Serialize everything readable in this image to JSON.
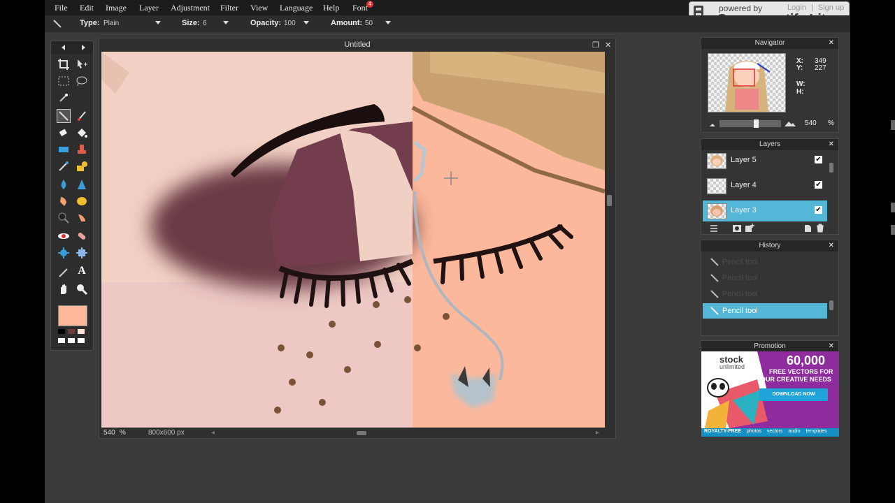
{
  "menu": {
    "items": [
      "File",
      "Edit",
      "Image",
      "Layer",
      "Adjustment",
      "Filter",
      "View",
      "Language",
      "Help",
      "Font"
    ],
    "font_badge": "4"
  },
  "watermark": {
    "powered_by": "powered by",
    "brand": "Screencastify Lite",
    "login": "Login",
    "sep": "|",
    "signup": "Sign up"
  },
  "options": {
    "type_label": "Type:",
    "type_value": "Plain",
    "size_label": "Size:",
    "size_value": "6",
    "opacity_label": "Opacity:",
    "opacity_value": "100",
    "amount_label": "Amount:",
    "amount_value": "50"
  },
  "document": {
    "title": "Untitled",
    "zoom": "540",
    "zoom_unit": "%",
    "dimensions": "800x600 px"
  },
  "navigator": {
    "title": "Navigator",
    "x_label": "X:",
    "x_value": "349",
    "y_label": "Y:",
    "y_value": "227",
    "w_label": "W:",
    "h_label": "H:",
    "zoom": "540",
    "zoom_unit": "%",
    "zoom_slider_fraction": 0.6
  },
  "layers": {
    "title": "Layers",
    "items": [
      {
        "name": "Layer 5",
        "visible": true
      },
      {
        "name": "Layer 4",
        "visible": true
      },
      {
        "name": "Layer 3",
        "visible": true
      }
    ]
  },
  "history": {
    "title": "History",
    "items": [
      "Pencil tool",
      "Pencil tool",
      "Pencil tool",
      "Pencil tool"
    ]
  },
  "promotion": {
    "title": "Promotion",
    "brand": "stock",
    "brand_sub": "unlimited",
    "big": "60,000",
    "line1": "FREE VECTORS FOR",
    "line2": "YOUR CREATIVE NEEDS",
    "cta": "DOWNLOAD NOW",
    "footer": [
      "ROYALTY-FREE",
      "photos",
      "vectors",
      "audio",
      "templates"
    ]
  },
  "colors": {
    "primary": "#ffb89c",
    "selection": "#54b7d8"
  }
}
